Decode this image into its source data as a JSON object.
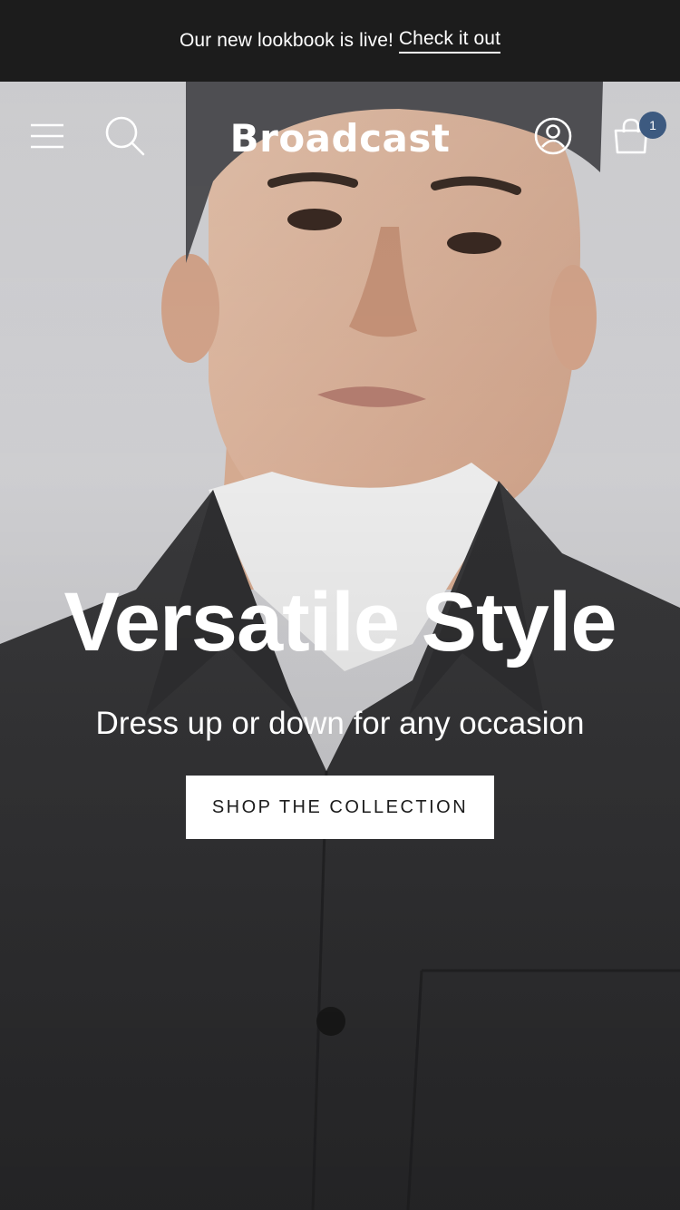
{
  "announcement": {
    "message": "Our new lookbook is live!",
    "link_label": "Check it out"
  },
  "header": {
    "logo": "Broadcast",
    "menu_icon": "hamburger-menu-icon",
    "search_icon": "search-icon",
    "account_icon": "account-icon",
    "cart_icon": "shopping-bag-icon",
    "cart_count": "1"
  },
  "hero": {
    "title": "Versatile Style",
    "subtitle": "Dress up or down for any occasion",
    "cta_label": "SHOP THE COLLECTION"
  },
  "colors": {
    "announcement_bg": "#1c1c1c",
    "badge": "#3d5a80",
    "button_bg": "#ffffff",
    "button_text": "#1c1c1c"
  }
}
